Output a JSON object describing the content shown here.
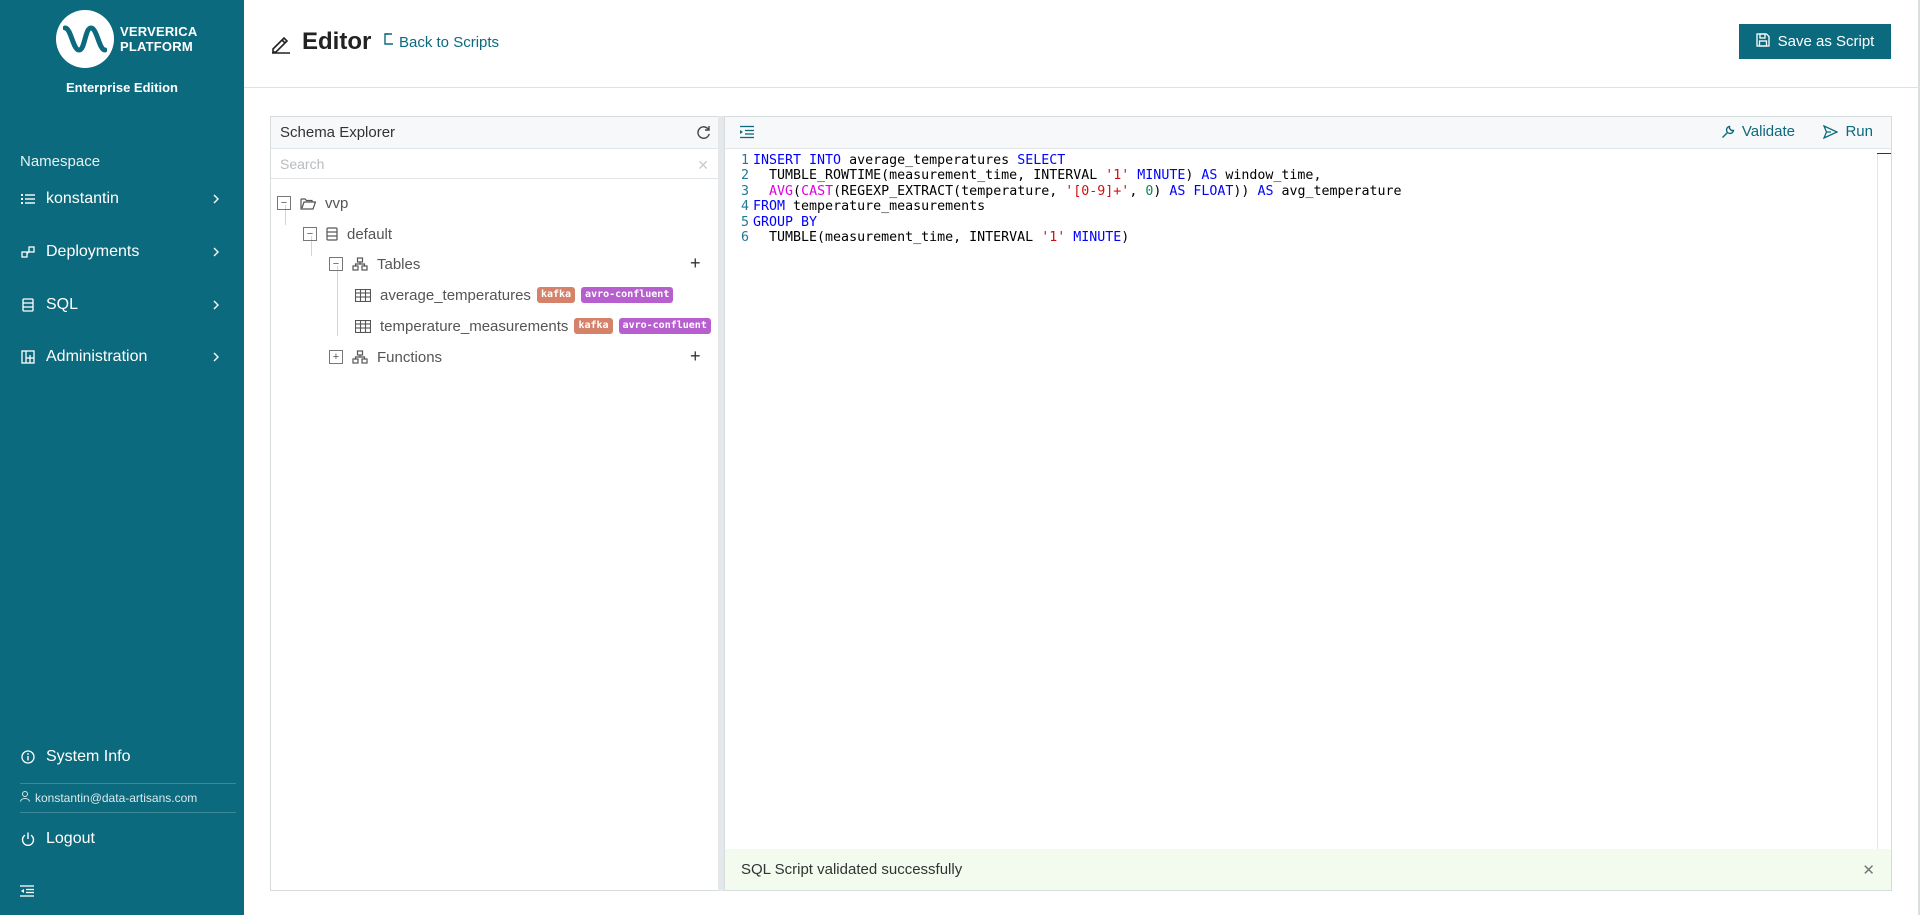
{
  "sidebar": {
    "logo_line1": "VERVERICA",
    "logo_line2": "PLATFORM",
    "edition": "Enterprise Edition",
    "namespace_label": "Namespace",
    "items": [
      {
        "label": "konstantin",
        "icon": "list-icon"
      },
      {
        "label": "Deployments",
        "icon": "deployments-icon"
      },
      {
        "label": "SQL",
        "icon": "database-icon"
      },
      {
        "label": "Administration",
        "icon": "dashboard-icon"
      }
    ],
    "system_info": "System Info",
    "user_email": "konstantin@data-artisans.com",
    "logout": "Logout"
  },
  "header": {
    "title": "Editor",
    "back_link": "Back to Scripts",
    "save_button": "Save as Script"
  },
  "schema_explorer": {
    "title": "Schema Explorer",
    "search_placeholder": "Search",
    "catalog": "vvp",
    "database": "default",
    "tables_label": "Tables",
    "tables": [
      {
        "name": "average_temperatures",
        "badges": [
          "kafka",
          "avro-confluent"
        ]
      },
      {
        "name": "temperature_measurements",
        "badges": [
          "kafka",
          "avro-confluent"
        ]
      }
    ],
    "functions_label": "Functions"
  },
  "editor": {
    "validate_label": "Validate",
    "run_label": "Run",
    "line_numbers": [
      "1",
      "2",
      "3",
      "4",
      "5",
      "6"
    ],
    "toast_message": "SQL Script validated successfully"
  },
  "colors": {
    "brand": "#0b6a7d",
    "keyword": "#0000ff",
    "function": "#e000e0",
    "string": "#d01010",
    "number": "#098658",
    "badge_kafka": "#d4826a",
    "badge_avro": "#b75fce",
    "toast_bg": "#f3fbef"
  }
}
